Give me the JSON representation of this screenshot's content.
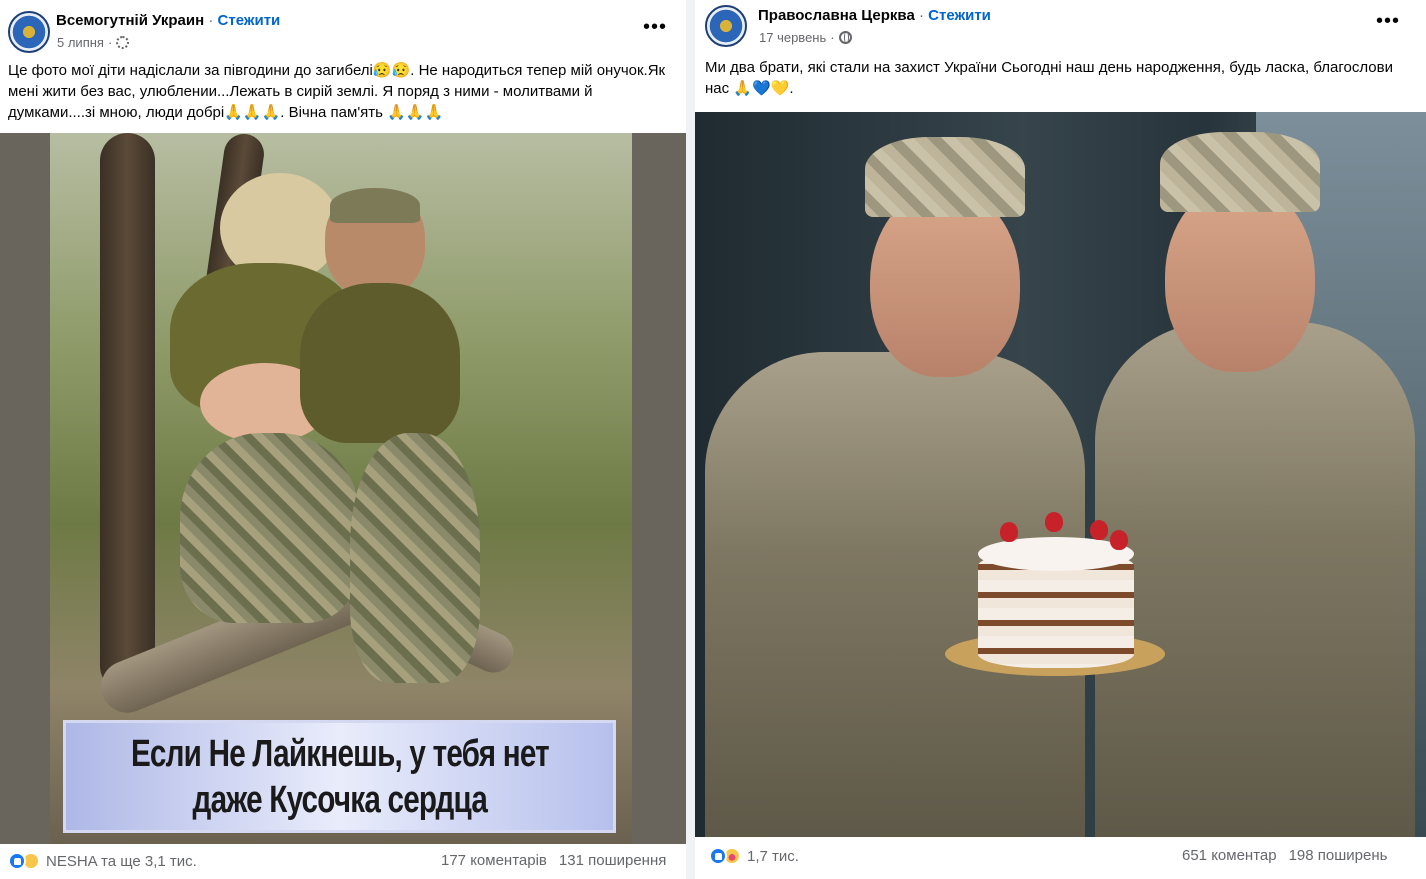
{
  "posts": [
    {
      "page_name": "Всемогутній Украин",
      "separator": "·",
      "follow_label": "Стежити",
      "date": "5 липня",
      "date_separator": "·",
      "privacy_icon": "gear-icon",
      "more_label": "•••",
      "caption": "Це фото мої діти надіслали за півгодини до загибелі😥😥. Не народиться тепер мій онучок.Як мені жити без вас, улюблении...Лежать в сирій землі. Я поряд з ними - молитвами й думками....зі мною, люди добрі🙏🙏🙏. Вічна пам'ять 🙏🙏🙏",
      "image_text_line1": "Если Не Лайкнешь, у тебя нет",
      "image_text_line2": "даже Кусочка сердца",
      "reactions": [
        "like",
        "sad"
      ],
      "reaction_text": "NESHA та ще 3,1 тис.",
      "comments": "177 коментарів",
      "shares": "131 поширення"
    },
    {
      "page_name": "Православна Церква",
      "separator": "·",
      "follow_label": "Стежити",
      "date": "17 червень",
      "date_separator": "·",
      "privacy_icon": "globe-icon",
      "more_label": "•••",
      "caption": "Ми два брати, які стали на захист України Сьогодні наш день народження, будь ласка, благослови нас 🙏💙💛.",
      "reactions": [
        "like",
        "care"
      ],
      "reaction_text": "1,7 тис.",
      "comments": "651 коментар",
      "shares": "198 поширень"
    }
  ],
  "colors": {
    "accent": "#0064d1",
    "like": "#1877f2",
    "muted": "#65676b",
    "background": "#f0f2f5"
  }
}
